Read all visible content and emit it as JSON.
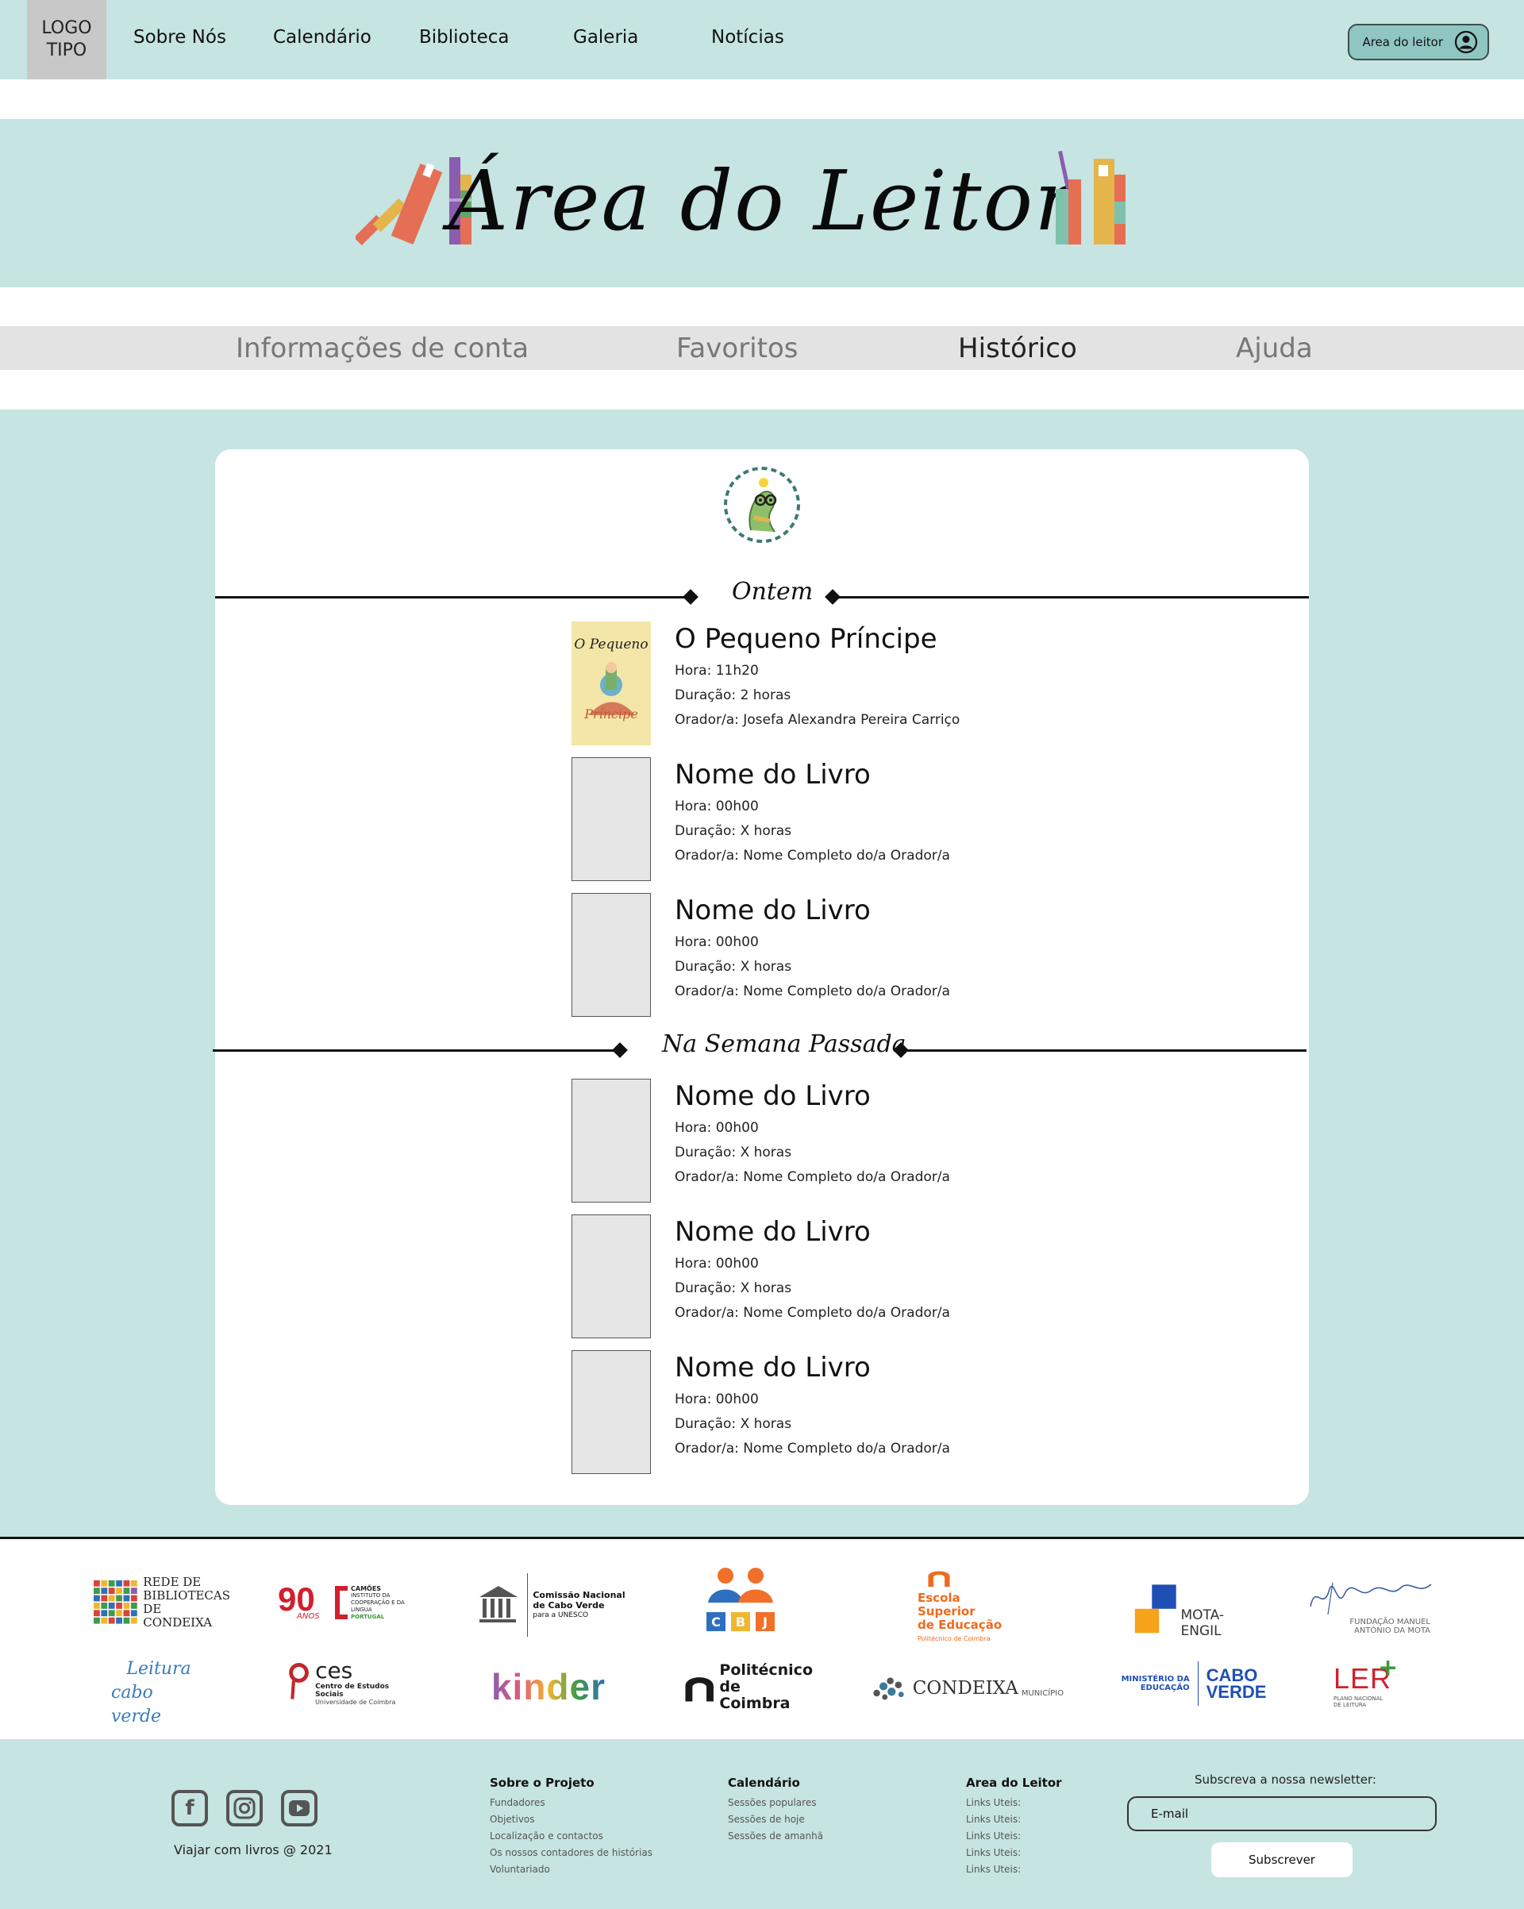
{
  "nav": {
    "logo_line1": "LOGO",
    "logo_line2": "TIPO",
    "links": [
      "Sobre Nós",
      "Calendário",
      "Biblioteca",
      "Galeria",
      "Notícias"
    ],
    "reader_button": "Area do leitor"
  },
  "banner": {
    "title": "Área do Leitor"
  },
  "tabs": [
    {
      "label": "Informações de conta"
    },
    {
      "label": "Favoritos"
    },
    {
      "label": "Histórico"
    },
    {
      "label": "Ajuda"
    }
  ],
  "active_tab": "Histórico",
  "history": {
    "sections": [
      {
        "label": "Ontem",
        "entries": [
          {
            "title": "O Pequeno Príncipe",
            "hora": "Hora: 11h20",
            "duracao": "Duração: 2 horas",
            "orador": "Orador/a: Josefa Alexandra Pereira Carriço",
            "cover_title_top": "O Pequeno",
            "cover_title_bottom": "Príncipe"
          },
          {
            "title": "Nome do Livro",
            "hora": "Hora: 00h00",
            "duracao": "Duração: X horas",
            "orador": "Orador/a: Nome Completo do/a Orador/a"
          },
          {
            "title": "Nome do Livro",
            "hora": "Hora: 00h00",
            "duracao": "Duração: X horas",
            "orador": "Orador/a: Nome Completo do/a Orador/a"
          }
        ]
      },
      {
        "label": "Na Semana Passada",
        "entries": [
          {
            "title": "Nome do Livro",
            "hora": "Hora: 00h00",
            "duracao": "Duração: X horas",
            "orador": "Orador/a: Nome Completo do/a Orador/a"
          },
          {
            "title": "Nome do Livro",
            "hora": "Hora: 00h00",
            "duracao": "Duração: X horas",
            "orador": "Orador/a: Nome Completo do/a Orador/a"
          },
          {
            "title": "Nome do Livro",
            "hora": "Hora: 00h00",
            "duracao": "Duração: X horas",
            "orador": "Orador/a: Nome Completo do/a Orador/a"
          }
        ]
      }
    ]
  },
  "partners": {
    "row1": [
      {
        "name": "Rede de Bibliotecas de Condeixa",
        "l1": "REDE DE",
        "l2": "BIBLIOTECAS",
        "l3": "DE CONDEIXA"
      },
      {
        "name": "Camões 90 anos",
        "big": "90",
        "small": "ANOS",
        "l1": "CAMÕES",
        "l2": "INSTITUTO DA COOPERAÇÃO E DA LÍNGUA",
        "l3": "PORTUGAL"
      },
      {
        "name": "Comissão Nacional de Cabo Verde para a UNESCO",
        "l1": "Comissão Nacional",
        "l2": "de Cabo Verde",
        "l3": "para a UNESCO"
      },
      {
        "name": "Colégio Bom Jesus",
        "l1": "C",
        "l2": "B",
        "l3": "J"
      },
      {
        "name": "Escola Superior de Educação",
        "l1": "Escola Superior",
        "l2": "de Educação",
        "l3": "Politécnico de Coimbra"
      },
      {
        "name": "Mota-Engil",
        "l1": "MOTA-ENGIL"
      },
      {
        "name": "Fundação Manuel António da Mota",
        "l1": "FUNDAÇÃO MANUEL",
        "l2": "ANTÓNIO DA MOTA"
      }
    ],
    "row2": [
      {
        "name": "Leitura Cabo Verde",
        "l1": "Leitura",
        "l2": "cabo verde"
      },
      {
        "name": "Centro de Estudos Sociais",
        "l1": "ces",
        "l2": "Centro de Estudos Sociais",
        "l3": "Universidade de Coimbra"
      },
      {
        "name": "Kinder",
        "l1": "kinder"
      },
      {
        "name": "Politécnico de Coimbra",
        "l1": "Politécnico",
        "l2": "de Coimbra"
      },
      {
        "name": "Condeixa Município",
        "l1": "CONDEIXA",
        "l2": "MUNICÍPIO"
      },
      {
        "name": "Ministério da Educação Cabo Verde",
        "l1": "MINISTÉRIO DA",
        "l2": "EDUCAÇÃO",
        "l3": "CABO",
        "l4": "VERDE"
      },
      {
        "name": "LER Plano Nacional de Leitura",
        "l1": "LER",
        "l2": "PLANO NACIONAL",
        "l3": "DE LEITURA"
      }
    ]
  },
  "footer": {
    "social": [
      "facebook-icon",
      "instagram-icon",
      "youtube-icon"
    ],
    "copyright": "Viajar com livros @ 2021",
    "columns": [
      {
        "heading": "Sobre o Projeto",
        "items": [
          "Fundadores",
          "Objetivos",
          "Localização e contactos",
          "Os nossos contadores de histórias",
          "Voluntariado"
        ]
      },
      {
        "heading": "Calendário",
        "items": [
          "Sessões populares",
          "Sessões de hoje",
          "Sessões de amanhã"
        ]
      },
      {
        "heading": "Area do Leitor",
        "items": [
          "Links Uteis:",
          "Links Uteis:",
          "Links Uteis:",
          "Links Uteis:",
          "Links Uteis:"
        ]
      }
    ],
    "newsletter_label": "Subscreva a nossa newsletter:",
    "email_placeholder": "E-mail",
    "subscribe_button": "Subscrever"
  },
  "colors": {
    "mint": "#c6e4e1",
    "button": "#8fc6c2",
    "tab_bar": "#e3e3e3"
  }
}
